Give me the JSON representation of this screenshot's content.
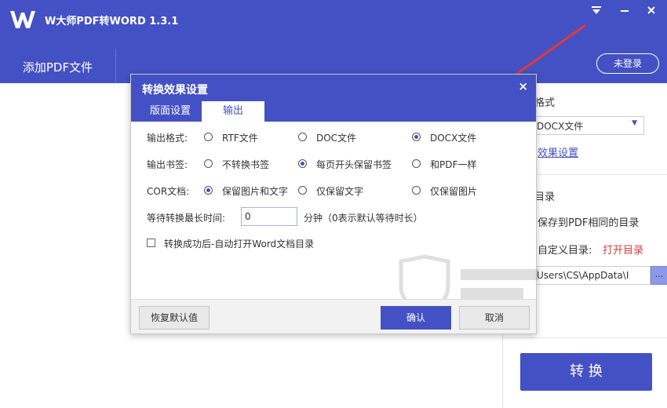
{
  "app": {
    "title": "W大师PDF转WORD 1.3.1"
  },
  "toolbar": {
    "add_pdf": "添加PDF文件",
    "login": "未登录"
  },
  "right_panel": {
    "format_label": "格式",
    "format_value": "DOCX文件",
    "effect_link": "效果设置",
    "dir_label": "目录",
    "same_dir": "保存到PDF相同的目录",
    "custom_dir": "自定义目录:",
    "open_dir": "打开目录",
    "path_value": "Users\\CS\\AppData\\I",
    "browse": "...",
    "convert": "转 换"
  },
  "dialog": {
    "title": "转换效果设置",
    "close": "×",
    "tabs": [
      "版面设置",
      "输出"
    ],
    "output_format": {
      "label": "输出格式:",
      "options": [
        "RTF文件",
        "DOC文件",
        "DOCX文件"
      ],
      "selected": "DOCX文件"
    },
    "bookmark": {
      "label": "输出书签:",
      "options": [
        "不转换书签",
        "每页开头保留书签",
        "和PDF一样"
      ],
      "selected": "每页开头保留书签"
    },
    "ocr": {
      "label": "COR文档:",
      "options": [
        "保留图片和文字",
        "仅保留文字",
        "仅保留图片"
      ],
      "selected": "保留图片和文字"
    },
    "wait": {
      "label": "等待转换最长时间:",
      "value": "0",
      "unit": "分钟（0表示默认等待时长）"
    },
    "auto_open": {
      "label": "转换成功后-自动打开Word文档目录",
      "checked": false
    },
    "buttons": {
      "restore": "恢复默认值",
      "ok": "确认",
      "cancel": "取消"
    }
  },
  "icons": {
    "logo": "w-logo-icon",
    "menu": "menu-icon",
    "minimize": "minimize-icon",
    "close": "close-icon",
    "dropdown": "caret-down-icon",
    "arrow": "red-arrow-icon"
  },
  "colors": {
    "primary": "#4451c4",
    "link": "#4451c4",
    "accent_red": "#e03a3a",
    "browse": "#8d98e6"
  }
}
